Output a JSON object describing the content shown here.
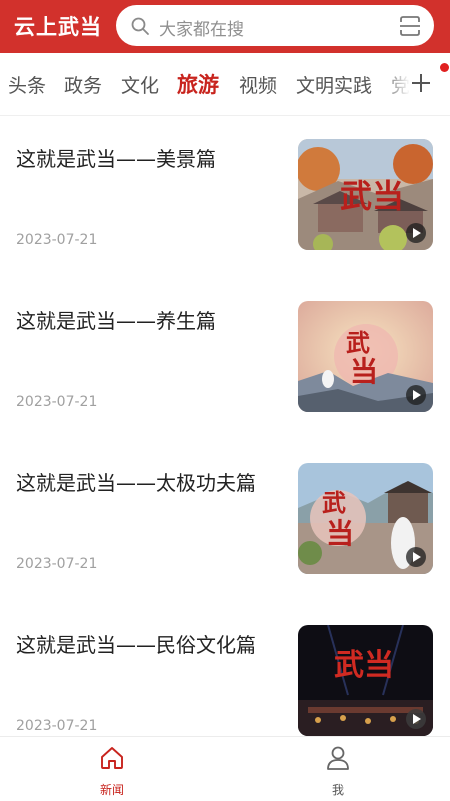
{
  "header": {
    "app_title": "云上武当",
    "search": {
      "placeholder": "大家都在搜"
    }
  },
  "tabs": [
    {
      "label": "头条",
      "active": false
    },
    {
      "label": "政务",
      "active": false
    },
    {
      "label": "文化",
      "active": false
    },
    {
      "label": "旅游",
      "active": true
    },
    {
      "label": "视频",
      "active": false
    },
    {
      "label": "文明实践",
      "active": false
    },
    {
      "label": "党",
      "active": false
    }
  ],
  "feed": {
    "items": [
      {
        "title": "这就是武当——美景篇",
        "date": "2023-07-21",
        "thumb_calligraphy": "武当",
        "thumb_scene": "temple-autumn"
      },
      {
        "title": "这就是武当——养生篇",
        "date": "2023-07-21",
        "thumb_calligraphy": "武当",
        "thumb_scene": "sunrise-meditation"
      },
      {
        "title": "这就是武当——太极功夫篇",
        "date": "2023-07-21",
        "thumb_calligraphy": "武当",
        "thumb_scene": "taichi-courtyard"
      },
      {
        "title": "这就是武当——民俗文化篇",
        "date": "2023-07-21",
        "thumb_calligraphy": "武当",
        "thumb_scene": "night-stage"
      }
    ]
  },
  "bottom_nav": {
    "items": [
      {
        "label": "新闻",
        "icon": "home-icon",
        "active": true
      },
      {
        "label": "我",
        "icon": "user-icon",
        "active": false
      }
    ]
  },
  "colors": {
    "brand_red": "#d2312c",
    "active_tab": "#c8241e",
    "date_gray": "#a0a0a0"
  }
}
